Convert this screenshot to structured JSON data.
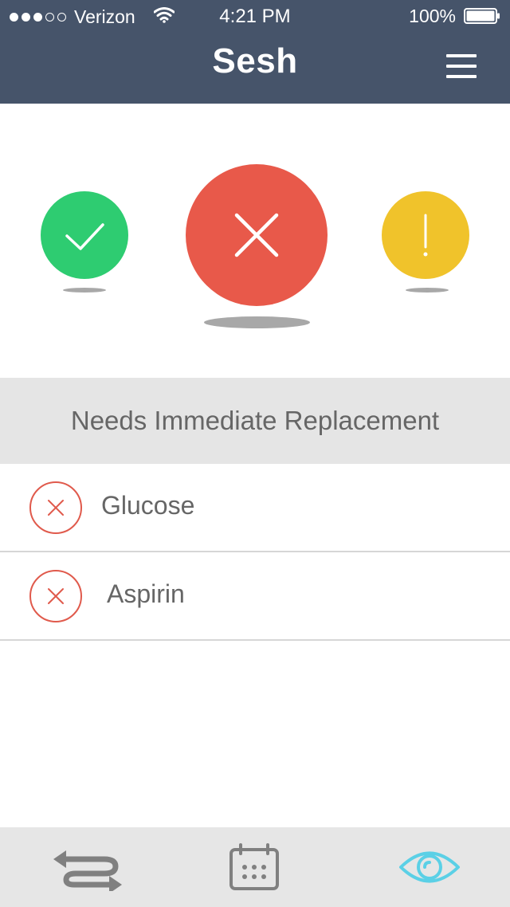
{
  "status_bar": {
    "carrier": "Verizon",
    "time": "4:21 PM",
    "battery": "100%"
  },
  "header": {
    "title": "Sesh",
    "menu_icon": "hamburger-menu-icon"
  },
  "status_indicators": [
    {
      "state": "ok",
      "icon": "checkmark-icon",
      "color": "#2ecc71",
      "selected": false
    },
    {
      "state": "replace",
      "icon": "x-icon",
      "color": "#e8594a",
      "selected": true
    },
    {
      "state": "warning",
      "icon": "exclamation-icon",
      "color": "#f0c32b",
      "selected": false
    }
  ],
  "section": {
    "title": "Needs Immediate Replacement"
  },
  "items": [
    {
      "label": "Glucose",
      "icon": "x-circle-icon"
    },
    {
      "label": "Aspirin",
      "icon": "x-circle-icon"
    }
  ],
  "tab_bar": {
    "tabs": [
      {
        "icon": "transfer-arrows-icon",
        "active": false
      },
      {
        "icon": "calendar-icon",
        "active": false
      },
      {
        "icon": "eye-icon",
        "active": true
      }
    ],
    "active_color": "#5bd0e6",
    "inactive_color": "#808080"
  },
  "colors": {
    "header_bg": "#46546a",
    "accent_red": "#e8594a",
    "accent_green": "#2ecc71",
    "accent_yellow": "#f0c32b"
  }
}
